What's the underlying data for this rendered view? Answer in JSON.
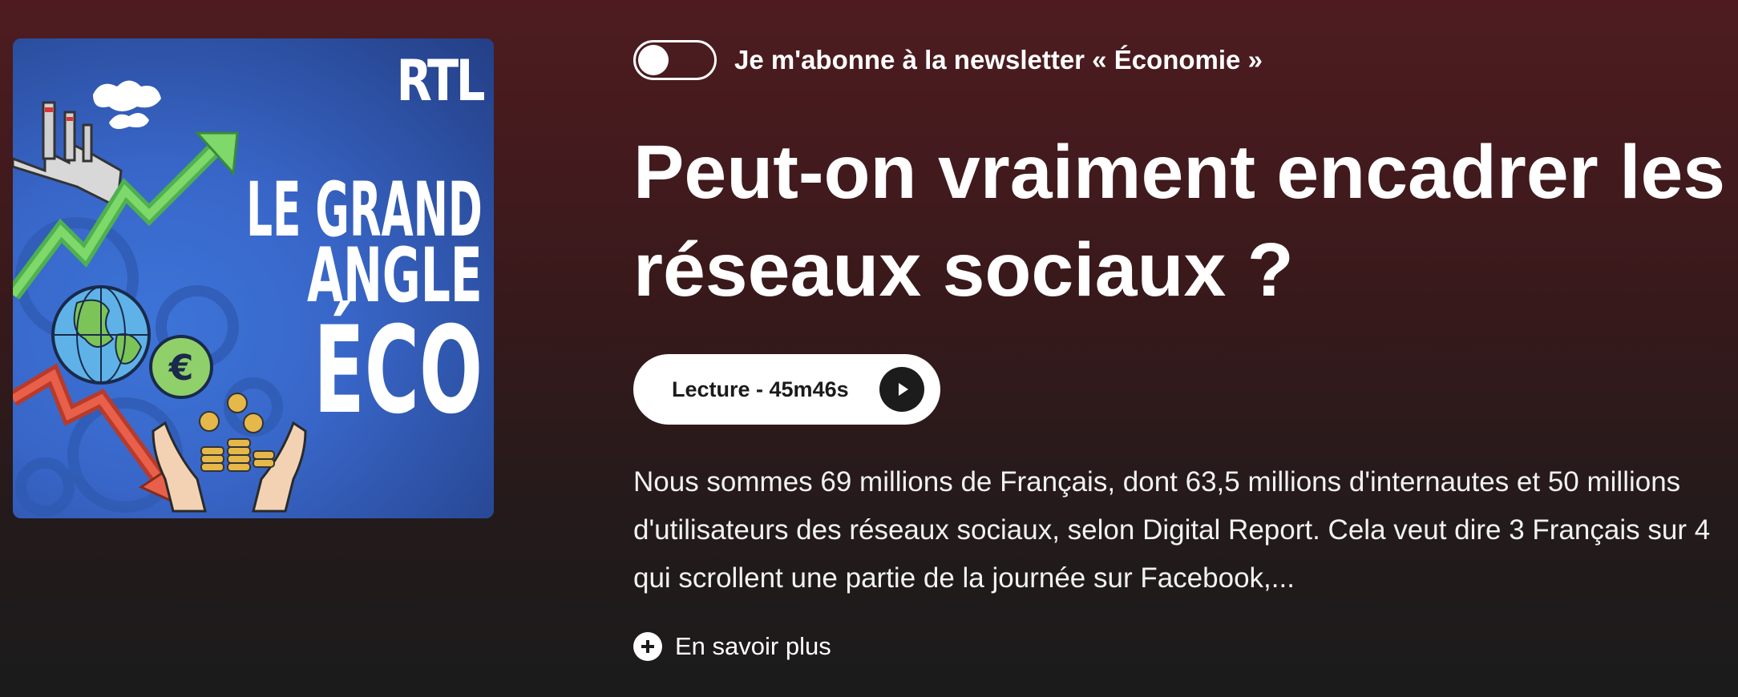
{
  "cover": {
    "brand": "RTL",
    "title_line1": "LE GRAND",
    "title_line2": "ANGLE",
    "title_line3": "ÉCO"
  },
  "newsletter": {
    "label": "Je m'abonne à la newsletter « Économie »",
    "enabled": false
  },
  "episode": {
    "title": "Peut-on vraiment encadrer les réseaux sociaux ?",
    "play_label": "Lecture - 45m46s",
    "description": "Nous sommes 69 millions de Français, dont 63,5 millions d'internautes et 50 millions d'utilisateurs des réseaux sociaux, selon Digital Report. Cela veut dire 3 Français sur 4 qui scrollent une partie de la journée sur Facebook,...",
    "more_label": "En savoir plus"
  },
  "icons": {
    "play": "play-icon",
    "more": "plus-circle-icon"
  },
  "colors": {
    "background_top": "#4e1c20",
    "background_bottom": "#1b1b1b",
    "button_bg": "#ffffff",
    "cover_blue": "#3866c8"
  }
}
